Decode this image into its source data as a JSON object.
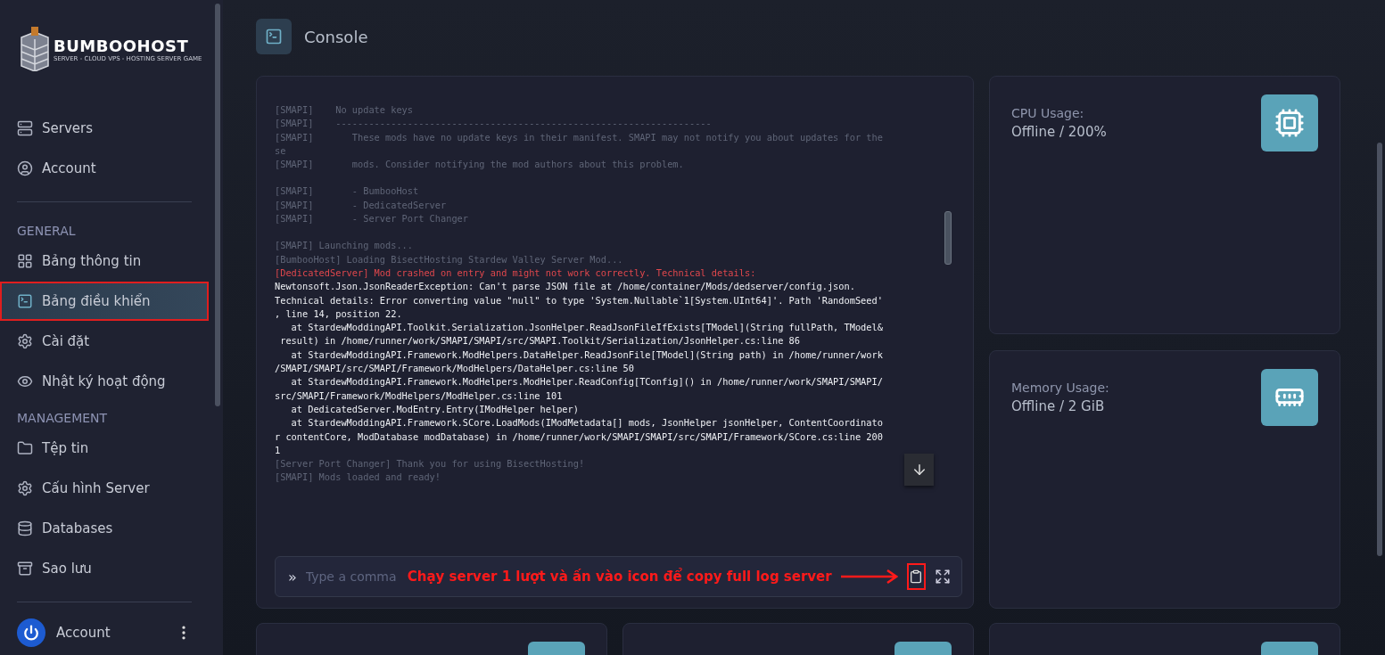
{
  "brand": {
    "name": "BUMBOOHOST",
    "tagline": "SERVER - CLOUD VPS - HOSTING SERVER GAME"
  },
  "sidebar": {
    "top_items": [
      {
        "label": "Servers",
        "selected": false
      },
      {
        "label": "Account",
        "selected": false
      }
    ],
    "sections": [
      {
        "title": "GENERAL",
        "items": [
          {
            "label": "Bảng thông tin",
            "selected": false
          },
          {
            "label": "Bảng điều khiển",
            "selected": true
          },
          {
            "label": "Cài đặt",
            "selected": false
          },
          {
            "label": "Nhật ký hoạt động",
            "selected": false
          }
        ]
      },
      {
        "title": "MANAGEMENT",
        "items": [
          {
            "label": "Tệp tin",
            "selected": false
          },
          {
            "label": "Cấu hình Server",
            "selected": false
          },
          {
            "label": "Databases",
            "selected": false
          },
          {
            "label": "Sao lưu",
            "selected": false
          }
        ]
      }
    ],
    "account": {
      "label": "Account"
    }
  },
  "page": {
    "title": "Console"
  },
  "console": {
    "lines": [
      {
        "kind": "dim",
        "text": "[SMAPI]    No update keys"
      },
      {
        "kind": "dim",
        "text": "[SMAPI]    --------------------------------------------------------------------"
      },
      {
        "kind": "dim",
        "text": "[SMAPI]       These mods have no update keys in their manifest. SMAPI may not notify you about updates for the"
      },
      {
        "kind": "dim",
        "text": "se"
      },
      {
        "kind": "dim",
        "text": "[SMAPI]       mods. Consider notifying the mod authors about this problem.",
        "gap_after": true
      },
      {
        "kind": "dim",
        "text": "[SMAPI]       - BumbooHost"
      },
      {
        "kind": "dim",
        "text": "[SMAPI]       - DedicatedServer"
      },
      {
        "kind": "dim",
        "text": "[SMAPI]       - Server Port Changer",
        "gap_after": true
      },
      {
        "kind": "dim",
        "text": "[SMAPI] Launching mods..."
      },
      {
        "kind": "dim",
        "text": "[BumbooHost] Loading BisectHosting Stardew Valley Server Mod..."
      },
      {
        "kind": "error",
        "text": "[DedicatedServer] Mod crashed on entry and might not work correctly. Technical details:"
      },
      {
        "kind": "normal",
        "text": "Newtonsoft.Json.JsonReaderException: Can't parse JSON file at /home/container/Mods/dedserver/config.json."
      },
      {
        "kind": "normal",
        "text": "Technical details: Error converting value \"null\" to type 'System.Nullable`1[System.UInt64]'. Path 'RandomSeed'"
      },
      {
        "kind": "normal",
        "text": ", line 14, position 22."
      },
      {
        "kind": "normal",
        "text": "   at StardewModdingAPI.Toolkit.Serialization.JsonHelper.ReadJsonFileIfExists[TModel](String fullPath, TModel&"
      },
      {
        "kind": "normal",
        "text": " result) in /home/runner/work/SMAPI/SMAPI/src/SMAPI.Toolkit/Serialization/JsonHelper.cs:line 86"
      },
      {
        "kind": "normal",
        "text": "   at StardewModdingAPI.Framework.ModHelpers.DataHelper.ReadJsonFile[TModel](String path) in /home/runner/work"
      },
      {
        "kind": "normal",
        "text": "/SMAPI/SMAPI/src/SMAPI/Framework/ModHelpers/DataHelper.cs:line 50"
      },
      {
        "kind": "normal",
        "text": "   at StardewModdingAPI.Framework.ModHelpers.ModHelper.ReadConfig[TConfig]() in /home/runner/work/SMAPI/SMAPI/"
      },
      {
        "kind": "normal",
        "text": "src/SMAPI/Framework/ModHelpers/ModHelper.cs:line 101"
      },
      {
        "kind": "normal",
        "text": "   at DedicatedServer.ModEntry.Entry(IModHelper helper)"
      },
      {
        "kind": "normal",
        "text": "   at StardewModdingAPI.Framework.SCore.LoadMods(IModMetadata[] mods, JsonHelper jsonHelper, ContentCoordinato"
      },
      {
        "kind": "normal",
        "text": "r contentCore, ModDatabase modDatabase) in /home/runner/work/SMAPI/SMAPI/src/SMAPI/Framework/SCore.cs:line 200"
      },
      {
        "kind": "normal",
        "text": "1"
      },
      {
        "kind": "dim",
        "text": "[Server Port Changer] Thank you for using BisectHosting!"
      },
      {
        "kind": "dim",
        "text": "[SMAPI] Mods loaded and ready!"
      }
    ],
    "prompt": "»",
    "placeholder": "Type a comma",
    "annotation": "Chạy server 1 lượt và ấn vào icon để copy full log server"
  },
  "stats": [
    {
      "label": "CPU Usage:",
      "value": "Offline / 200%"
    },
    {
      "label": "Memory Usage:",
      "value": "Offline / 2 GiB"
    }
  ]
}
